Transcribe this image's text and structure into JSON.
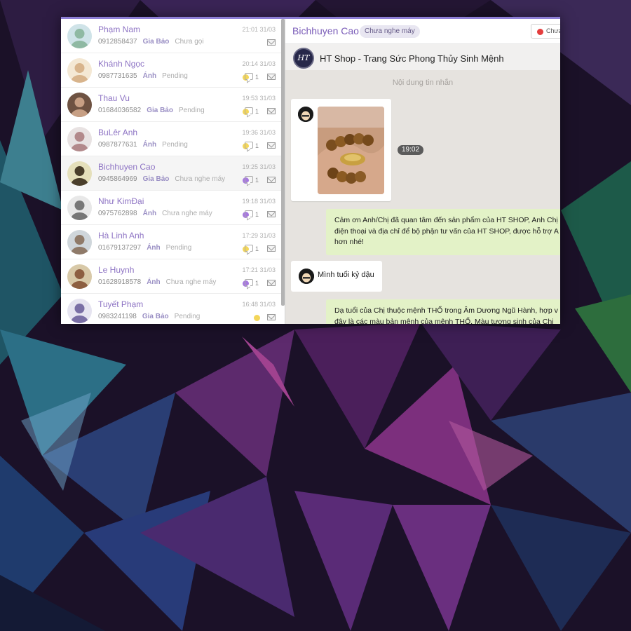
{
  "conversations": [
    {
      "name": "Phạm Nam",
      "phone": "0912858437",
      "agent": "Gia Bảo",
      "status": "Chưa gọi",
      "time": "21:01 31/03",
      "dot_color": null,
      "count": null
    },
    {
      "name": "Khánh Ngọc",
      "phone": "0987731635",
      "agent": "Ánh",
      "status": "Pending",
      "time": "20:14 31/03",
      "dot_color": "#f3d65a",
      "count": "1"
    },
    {
      "name": "Thau Vu",
      "phone": "01684036582",
      "agent": "Gia Bảo",
      "status": "Pending",
      "time": "19:53 31/03",
      "dot_color": "#f3d65a",
      "count": "1"
    },
    {
      "name": "BuLêr Anh",
      "phone": "0987877631",
      "agent": "Ánh",
      "status": "Pending",
      "time": "19:36 31/03",
      "dot_color": "#f3d65a",
      "count": "1"
    },
    {
      "name": "Bichhuyen Cao",
      "phone": "0945864969",
      "agent": "Gia Bảo",
      "status": "Chưa nghe máy",
      "time": "19:25 31/03",
      "dot_color": "#a779df",
      "count": "1"
    },
    {
      "name": "Như KimĐại",
      "phone": "0975762898",
      "agent": "Ánh",
      "status": "Chưa nghe máy",
      "time": "19:18 31/03",
      "dot_color": "#a779df",
      "count": "1"
    },
    {
      "name": "Hà Linh Anh",
      "phone": "01679137297",
      "agent": "Ánh",
      "status": "Pending",
      "time": "17:29 31/03",
      "dot_color": "#f3d65a",
      "count": "1"
    },
    {
      "name": "Le Huynh",
      "phone": "01628918578",
      "agent": "Ánh",
      "status": "Chưa nghe máy",
      "time": "17:21 31/03",
      "dot_color": "#a779df",
      "count": "1"
    },
    {
      "name": "Tuyết Phạm",
      "phone": "0983241198",
      "agent": "Gia Bảo",
      "status": "Pending",
      "time": "16:48 31/03",
      "dot_color": "#f3d65a",
      "count": null
    }
  ],
  "chat": {
    "title": "Bichhuyen Cao",
    "status": "Chưa nghe máy",
    "header_button": "Chưa",
    "shop_logo_text": "HT",
    "shop_name": "HT Shop - Trang Sức Phong Thủy Sinh Mệnh",
    "message_hint": "Nội dung tin nhắn",
    "image_time": "19:02",
    "reply1": [
      "Cảm ơn Anh/Chị đã quan tâm đến sản phẩm của HT SHOP, Anh Chị",
      "điện thoại và địa chỉ để bộ phận tư vấn của HT SHOP, được hỗ trợ A",
      "hơn nhé!"
    ],
    "incoming": "Mình tuổi kỷ dậu",
    "reply2": [
      "Dạ tuổi của Chị thuộc mệnh THỔ trong Âm Dương Ngũ Hành, hợp v",
      "đây là các màu bản mệnh của mệnh THỔ. Màu tương sinh của Chị"
    ]
  },
  "colors": {
    "accent": "#8e74c4",
    "pending": "#f3d65a",
    "not_answered": "#a779df",
    "outgoing_bubble": "#e3f2c7"
  }
}
